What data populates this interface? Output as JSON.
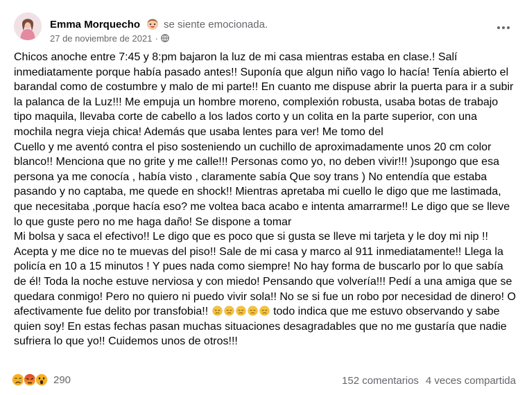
{
  "post": {
    "author": "Emma Morquecho",
    "feeling": "se siente emocionada.",
    "feeling_icon": "excited-face-icon",
    "date": "27 de noviembre de 2021",
    "separator": "·",
    "privacy_icon": "globe-icon",
    "more_icon": "more-options-icon",
    "paragraphs": [
      "Chicos anoche entre 7:45 y 8:pm bajaron la luz de mi casa mientras estaba en clase.! Salí inmediatamente porque había pasado antes!! Suponía que algun niño vago lo hacía! Tenía abierto el barandal como de costumbre y malo de mi parte!! En cuanto me dispuse abrir la puerta para ir a subir la palanca de la Luz!!! Me empuja un hombre moreno, complexión robusta, usaba botas de trabajo tipo maquila, llevaba corte de cabello a los lados corto y un colita en la parte superior, con una mochila negra vieja chica! Además que usaba lentes para ver!  Me tomo del",
      "Cuello y me aventó contra el piso sosteniendo un cuchillo de aproximadamente unos 20 cm color blanco!! Menciona que no grite y me calle!!! Personas como yo, no deben vivir!!! )supongo que esa persona ya me conocía , había visto , claramente sabía Que soy trans ) No entendía que estaba pasando y no captaba, me quede en shock!! Mientras apretaba mi cuello le digo que me lastimada, que necesitaba ,porque hacía eso? me voltea baca acabo e intenta amarrarme!! Le digo que se lleve lo que guste pero no me haga daño! Se dispone a tomar",
      "Mi bolsa y saca el efectivo!! Le digo que es poco que si gusta se lleve mi tarjeta y le doy mi nip !! Acepta y me dice no te muevas del piso!! Sale de mi casa y marco al 911 inmediatamente!! Llega la policía en 10 a 15 minutos ! Y pues nada como siempre! No hay forma de buscarlo por lo que sabía de él!  Toda la noche estuve nerviosa y con miedo! Pensando que volvería!!! Pedí a una amiga que se quedara conmigo! Pero no quiero ni puedo vivir sola!! No se si fue un robo por necesidad de dinero! O afectivamente fue delito por transfobia!!"
    ],
    "emoji_count": 5,
    "emoji_name": "disappointed-face-icon",
    "closing_text": " todo indica que me estuvo observando y sabe quien soy! En estas fechas pasan muchas situaciones desagradables que no me gustaría que nadie sufriera lo que yo!!  Cuidemos unos de otros!!!"
  },
  "footer": {
    "reaction_icons": [
      "sad-reaction-icon",
      "angry-reaction-icon",
      "wow-reaction-icon"
    ],
    "reaction_count": "290",
    "comments": "152 comentarios",
    "shares": "4 veces compartida"
  },
  "colors": {
    "text": "#050505",
    "secondary": "#65676b",
    "reaction_yellow": "#f7b125",
    "reaction_red": "#e9710f"
  }
}
